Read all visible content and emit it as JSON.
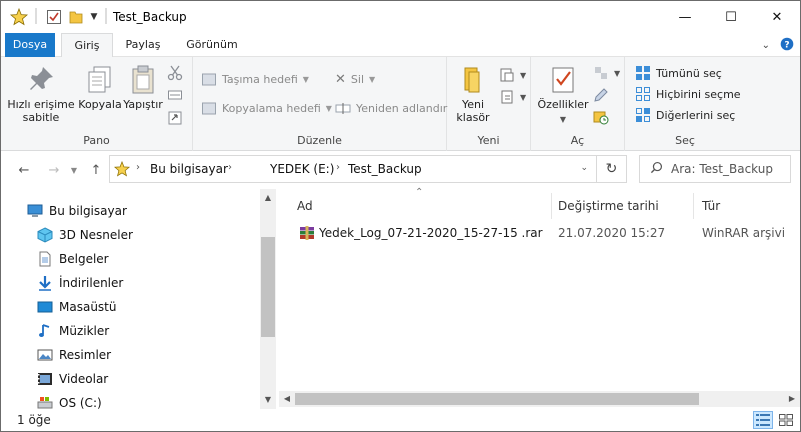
{
  "window": {
    "title": "Test_Backup",
    "minimize_glyph": "—",
    "maximize_glyph": "☐",
    "close_glyph": "✕"
  },
  "ribbon_tabs": {
    "file": "Dosya",
    "home": "Giriş",
    "share": "Paylaş",
    "view": "Görünüm"
  },
  "groups": {
    "clipboard": {
      "label": "Pano",
      "pin": "Hızlı erişime sabitle",
      "copy": "Kopyala",
      "paste": "Yapıştır"
    },
    "organize": {
      "label": "Düzenle",
      "move_to": "Taşıma hedefi",
      "copy_to": "Kopyalama hedefi",
      "delete": "Sil",
      "rename": "Yeniden adlandır"
    },
    "new": {
      "label": "Yeni",
      "new_folder": "Yeni klasör"
    },
    "open": {
      "label": "Aç",
      "properties": "Özellikler"
    },
    "select": {
      "label": "Seç",
      "select_all": "Tümünü seç",
      "select_none": "Hiçbirini seçme",
      "invert": "Diğerlerini seç"
    }
  },
  "address": {
    "crumbs": [
      "Bu bilgisayar",
      "YEDEK (E:)",
      "Test_Backup"
    ],
    "search_placeholder": "Ara: Test_Backup"
  },
  "nav_pane": {
    "items": [
      {
        "label": "Bu bilgisayar",
        "icon": "computer-icon"
      },
      {
        "label": "3D Nesneler",
        "icon": "3d-objects-icon"
      },
      {
        "label": "Belgeler",
        "icon": "documents-icon"
      },
      {
        "label": "İndirilenler",
        "icon": "downloads-icon"
      },
      {
        "label": "Masaüstü",
        "icon": "desktop-icon"
      },
      {
        "label": "Müzikler",
        "icon": "music-icon"
      },
      {
        "label": "Resimler",
        "icon": "pictures-icon"
      },
      {
        "label": "Videolar",
        "icon": "videos-icon"
      },
      {
        "label": "OS (C:)",
        "icon": "drive-icon"
      }
    ]
  },
  "file_list": {
    "columns": {
      "name": "Ad",
      "modified": "Değiştirme tarihi",
      "type": "Tür"
    },
    "rows": [
      {
        "name": "Yedek_Log_07-21-2020_15-27-15 .rar",
        "modified": "21.07.2020 15:27",
        "type": "WinRAR arşivi",
        "icon": "winrar-archive-icon"
      }
    ]
  },
  "status": {
    "item_count": "1 öğe"
  },
  "colors": {
    "file_tab": "#1979ca",
    "ribbon_bg": "#f5f6f7",
    "folder_yellow": "#f4c542",
    "accent_blue": "#1f6fc5"
  }
}
